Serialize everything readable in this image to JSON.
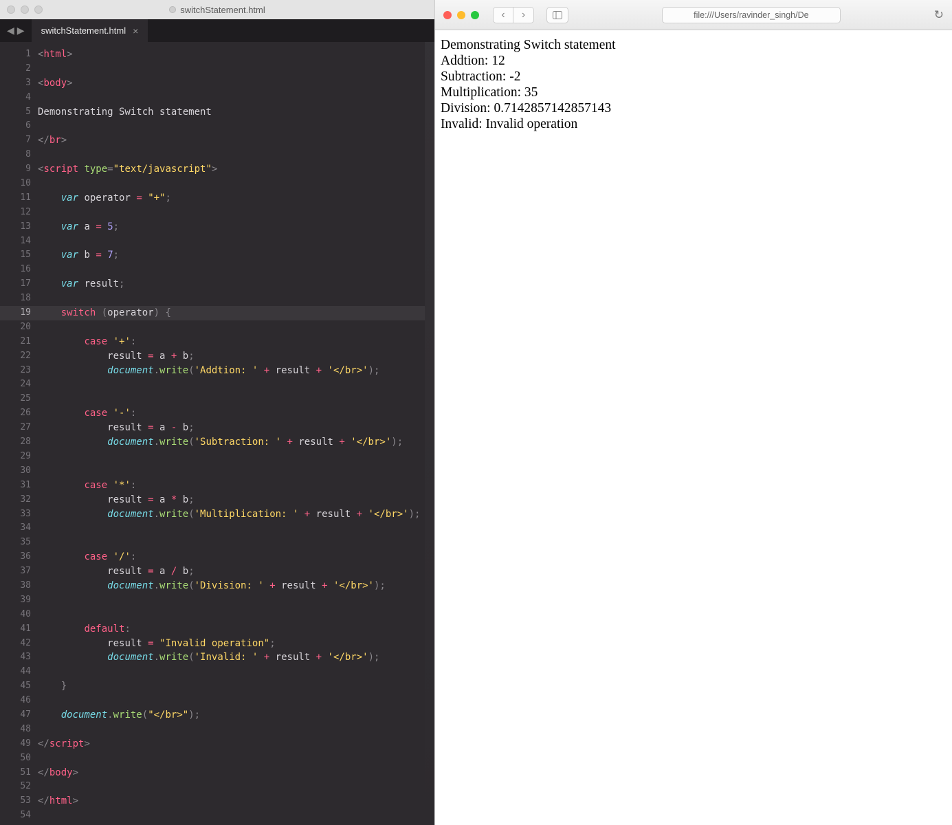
{
  "editor": {
    "window_title": "switchStatement.html",
    "tab": {
      "label": "switchStatement.html",
      "close": "×"
    },
    "arrows": {
      "back": "◀",
      "forward": "▶"
    },
    "line_count": 54,
    "current_line": 19,
    "code_lines": [
      {
        "t": "tagline",
        "parts": [
          {
            "c": "c-punc",
            "t": "<"
          },
          {
            "c": "c-tag",
            "t": "html"
          },
          {
            "c": "c-punc",
            "t": ">"
          }
        ]
      },
      {
        "t": "blank"
      },
      {
        "t": "tagline",
        "parts": [
          {
            "c": "c-punc",
            "t": "<"
          },
          {
            "c": "c-tag",
            "t": "body"
          },
          {
            "c": "c-punc",
            "t": ">"
          }
        ]
      },
      {
        "t": "blank"
      },
      {
        "t": "text",
        "parts": [
          {
            "c": "c-var",
            "t": "Demonstrating Switch statement"
          }
        ]
      },
      {
        "t": "blank"
      },
      {
        "t": "tagline",
        "parts": [
          {
            "c": "c-punc",
            "t": "</"
          },
          {
            "c": "c-tag",
            "t": "br"
          },
          {
            "c": "c-punc",
            "t": ">"
          }
        ]
      },
      {
        "t": "blank"
      },
      {
        "t": "tagline",
        "parts": [
          {
            "c": "c-punc",
            "t": "<"
          },
          {
            "c": "c-tag",
            "t": "script"
          },
          {
            "c": "",
            "t": " "
          },
          {
            "c": "c-attr",
            "t": "type"
          },
          {
            "c": "c-punc",
            "t": "="
          },
          {
            "c": "c-str",
            "t": "\"text/javascript\""
          },
          {
            "c": "c-punc",
            "t": ">"
          }
        ]
      },
      {
        "t": "blank"
      },
      {
        "t": "code",
        "indent": 1,
        "parts": [
          {
            "c": "c-kw",
            "t": "var"
          },
          {
            "c": "",
            "t": " "
          },
          {
            "c": "c-var",
            "t": "operator"
          },
          {
            "c": "",
            "t": " "
          },
          {
            "c": "c-op",
            "t": "="
          },
          {
            "c": "",
            "t": " "
          },
          {
            "c": "c-str",
            "t": "\"+\""
          },
          {
            "c": "c-punc",
            "t": ";"
          }
        ]
      },
      {
        "t": "blank"
      },
      {
        "t": "code",
        "indent": 1,
        "parts": [
          {
            "c": "c-kw",
            "t": "var"
          },
          {
            "c": "",
            "t": " "
          },
          {
            "c": "c-var",
            "t": "a"
          },
          {
            "c": "",
            "t": " "
          },
          {
            "c": "c-op",
            "t": "="
          },
          {
            "c": "",
            "t": " "
          },
          {
            "c": "c-num",
            "t": "5"
          },
          {
            "c": "c-punc",
            "t": ";"
          }
        ]
      },
      {
        "t": "blank"
      },
      {
        "t": "code",
        "indent": 1,
        "parts": [
          {
            "c": "c-kw",
            "t": "var"
          },
          {
            "c": "",
            "t": " "
          },
          {
            "c": "c-var",
            "t": "b"
          },
          {
            "c": "",
            "t": " "
          },
          {
            "c": "c-op",
            "t": "="
          },
          {
            "c": "",
            "t": " "
          },
          {
            "c": "c-num",
            "t": "7"
          },
          {
            "c": "c-punc",
            "t": ";"
          }
        ]
      },
      {
        "t": "blank"
      },
      {
        "t": "code",
        "indent": 1,
        "parts": [
          {
            "c": "c-kw",
            "t": "var"
          },
          {
            "c": "",
            "t": " "
          },
          {
            "c": "c-var",
            "t": "result"
          },
          {
            "c": "c-punc",
            "t": ";"
          }
        ]
      },
      {
        "t": "blank"
      },
      {
        "t": "code",
        "indent": 1,
        "parts": [
          {
            "c": "c-kw2",
            "t": "switch"
          },
          {
            "c": "",
            "t": " "
          },
          {
            "c": "c-punc",
            "t": "("
          },
          {
            "c": "c-var",
            "t": "operator"
          },
          {
            "c": "c-punc",
            "t": ")"
          },
          {
            "c": "",
            "t": " "
          },
          {
            "c": "c-punc",
            "t": "{"
          }
        ]
      },
      {
        "t": "blank"
      },
      {
        "t": "code",
        "indent": 2,
        "parts": [
          {
            "c": "c-kw2",
            "t": "case"
          },
          {
            "c": "",
            "t": " "
          },
          {
            "c": "c-str",
            "t": "'+'"
          },
          {
            "c": "c-punc",
            "t": ":"
          }
        ]
      },
      {
        "t": "code",
        "indent": 3,
        "parts": [
          {
            "c": "c-var",
            "t": "result"
          },
          {
            "c": "",
            "t": " "
          },
          {
            "c": "c-op",
            "t": "="
          },
          {
            "c": "",
            "t": " "
          },
          {
            "c": "c-var",
            "t": "a"
          },
          {
            "c": "",
            "t": " "
          },
          {
            "c": "c-op",
            "t": "+"
          },
          {
            "c": "",
            "t": " "
          },
          {
            "c": "c-var",
            "t": "b"
          },
          {
            "c": "c-punc",
            "t": ";"
          }
        ]
      },
      {
        "t": "code",
        "indent": 3,
        "parts": [
          {
            "c": "c-obj",
            "t": "document"
          },
          {
            "c": "c-punc",
            "t": "."
          },
          {
            "c": "c-fn",
            "t": "write"
          },
          {
            "c": "c-punc",
            "t": "("
          },
          {
            "c": "c-str",
            "t": "'Addtion: '"
          },
          {
            "c": "",
            "t": " "
          },
          {
            "c": "c-op",
            "t": "+"
          },
          {
            "c": "",
            "t": " "
          },
          {
            "c": "c-var",
            "t": "result"
          },
          {
            "c": "",
            "t": " "
          },
          {
            "c": "c-op",
            "t": "+"
          },
          {
            "c": "",
            "t": " "
          },
          {
            "c": "c-str",
            "t": "'</br>'"
          },
          {
            "c": "c-punc",
            "t": ");"
          }
        ]
      },
      {
        "t": "blank"
      },
      {
        "t": "blank"
      },
      {
        "t": "code",
        "indent": 2,
        "parts": [
          {
            "c": "c-kw2",
            "t": "case"
          },
          {
            "c": "",
            "t": " "
          },
          {
            "c": "c-str",
            "t": "'-'"
          },
          {
            "c": "c-punc",
            "t": ":"
          }
        ]
      },
      {
        "t": "code",
        "indent": 3,
        "parts": [
          {
            "c": "c-var",
            "t": "result"
          },
          {
            "c": "",
            "t": " "
          },
          {
            "c": "c-op",
            "t": "="
          },
          {
            "c": "",
            "t": " "
          },
          {
            "c": "c-var",
            "t": "a"
          },
          {
            "c": "",
            "t": " "
          },
          {
            "c": "c-op",
            "t": "-"
          },
          {
            "c": "",
            "t": " "
          },
          {
            "c": "c-var",
            "t": "b"
          },
          {
            "c": "c-punc",
            "t": ";"
          }
        ]
      },
      {
        "t": "code",
        "indent": 3,
        "parts": [
          {
            "c": "c-obj",
            "t": "document"
          },
          {
            "c": "c-punc",
            "t": "."
          },
          {
            "c": "c-fn",
            "t": "write"
          },
          {
            "c": "c-punc",
            "t": "("
          },
          {
            "c": "c-str",
            "t": "'Subtraction: '"
          },
          {
            "c": "",
            "t": " "
          },
          {
            "c": "c-op",
            "t": "+"
          },
          {
            "c": "",
            "t": " "
          },
          {
            "c": "c-var",
            "t": "result"
          },
          {
            "c": "",
            "t": " "
          },
          {
            "c": "c-op",
            "t": "+"
          },
          {
            "c": "",
            "t": " "
          },
          {
            "c": "c-str",
            "t": "'</br>'"
          },
          {
            "c": "c-punc",
            "t": ");"
          }
        ]
      },
      {
        "t": "blank"
      },
      {
        "t": "blank"
      },
      {
        "t": "code",
        "indent": 2,
        "parts": [
          {
            "c": "c-kw2",
            "t": "case"
          },
          {
            "c": "",
            "t": " "
          },
          {
            "c": "c-str",
            "t": "'*'"
          },
          {
            "c": "c-punc",
            "t": ":"
          }
        ]
      },
      {
        "t": "code",
        "indent": 3,
        "parts": [
          {
            "c": "c-var",
            "t": "result"
          },
          {
            "c": "",
            "t": " "
          },
          {
            "c": "c-op",
            "t": "="
          },
          {
            "c": "",
            "t": " "
          },
          {
            "c": "c-var",
            "t": "a"
          },
          {
            "c": "",
            "t": " "
          },
          {
            "c": "c-op",
            "t": "*"
          },
          {
            "c": "",
            "t": " "
          },
          {
            "c": "c-var",
            "t": "b"
          },
          {
            "c": "c-punc",
            "t": ";"
          }
        ]
      },
      {
        "t": "code",
        "indent": 3,
        "parts": [
          {
            "c": "c-obj",
            "t": "document"
          },
          {
            "c": "c-punc",
            "t": "."
          },
          {
            "c": "c-fn",
            "t": "write"
          },
          {
            "c": "c-punc",
            "t": "("
          },
          {
            "c": "c-str",
            "t": "'Multiplication: '"
          },
          {
            "c": "",
            "t": " "
          },
          {
            "c": "c-op",
            "t": "+"
          },
          {
            "c": "",
            "t": " "
          },
          {
            "c": "c-var",
            "t": "result"
          },
          {
            "c": "",
            "t": " "
          },
          {
            "c": "c-op",
            "t": "+"
          },
          {
            "c": "",
            "t": " "
          },
          {
            "c": "c-str",
            "t": "'</br>'"
          },
          {
            "c": "c-punc",
            "t": ");"
          }
        ]
      },
      {
        "t": "blank"
      },
      {
        "t": "blank"
      },
      {
        "t": "code",
        "indent": 2,
        "parts": [
          {
            "c": "c-kw2",
            "t": "case"
          },
          {
            "c": "",
            "t": " "
          },
          {
            "c": "c-str",
            "t": "'/'"
          },
          {
            "c": "c-punc",
            "t": ":"
          }
        ]
      },
      {
        "t": "code",
        "indent": 3,
        "parts": [
          {
            "c": "c-var",
            "t": "result"
          },
          {
            "c": "",
            "t": " "
          },
          {
            "c": "c-op",
            "t": "="
          },
          {
            "c": "",
            "t": " "
          },
          {
            "c": "c-var",
            "t": "a"
          },
          {
            "c": "",
            "t": " "
          },
          {
            "c": "c-op",
            "t": "/"
          },
          {
            "c": "",
            "t": " "
          },
          {
            "c": "c-var",
            "t": "b"
          },
          {
            "c": "c-punc",
            "t": ";"
          }
        ]
      },
      {
        "t": "code",
        "indent": 3,
        "parts": [
          {
            "c": "c-obj",
            "t": "document"
          },
          {
            "c": "c-punc",
            "t": "."
          },
          {
            "c": "c-fn",
            "t": "write"
          },
          {
            "c": "c-punc",
            "t": "("
          },
          {
            "c": "c-str",
            "t": "'Division: '"
          },
          {
            "c": "",
            "t": " "
          },
          {
            "c": "c-op",
            "t": "+"
          },
          {
            "c": "",
            "t": " "
          },
          {
            "c": "c-var",
            "t": "result"
          },
          {
            "c": "",
            "t": " "
          },
          {
            "c": "c-op",
            "t": "+"
          },
          {
            "c": "",
            "t": " "
          },
          {
            "c": "c-str",
            "t": "'</br>'"
          },
          {
            "c": "c-punc",
            "t": ");"
          }
        ]
      },
      {
        "t": "blank"
      },
      {
        "t": "blank"
      },
      {
        "t": "code",
        "indent": 2,
        "parts": [
          {
            "c": "c-kw2",
            "t": "default"
          },
          {
            "c": "c-punc",
            "t": ":"
          }
        ]
      },
      {
        "t": "code",
        "indent": 3,
        "parts": [
          {
            "c": "c-var",
            "t": "result"
          },
          {
            "c": "",
            "t": " "
          },
          {
            "c": "c-op",
            "t": "="
          },
          {
            "c": "",
            "t": " "
          },
          {
            "c": "c-str",
            "t": "\"Invalid operation\""
          },
          {
            "c": "c-punc",
            "t": ";"
          }
        ]
      },
      {
        "t": "code",
        "indent": 3,
        "parts": [
          {
            "c": "c-obj",
            "t": "document"
          },
          {
            "c": "c-punc",
            "t": "."
          },
          {
            "c": "c-fn",
            "t": "write"
          },
          {
            "c": "c-punc",
            "t": "("
          },
          {
            "c": "c-str",
            "t": "'Invalid: '"
          },
          {
            "c": "",
            "t": " "
          },
          {
            "c": "c-op",
            "t": "+"
          },
          {
            "c": "",
            "t": " "
          },
          {
            "c": "c-var",
            "t": "result"
          },
          {
            "c": "",
            "t": " "
          },
          {
            "c": "c-op",
            "t": "+"
          },
          {
            "c": "",
            "t": " "
          },
          {
            "c": "c-str",
            "t": "'</br>'"
          },
          {
            "c": "c-punc",
            "t": ");"
          }
        ]
      },
      {
        "t": "blank"
      },
      {
        "t": "code",
        "indent": 1,
        "parts": [
          {
            "c": "c-punc",
            "t": "}"
          }
        ]
      },
      {
        "t": "blank"
      },
      {
        "t": "code",
        "indent": 1,
        "parts": [
          {
            "c": "c-obj",
            "t": "document"
          },
          {
            "c": "c-punc",
            "t": "."
          },
          {
            "c": "c-fn",
            "t": "write"
          },
          {
            "c": "c-punc",
            "t": "("
          },
          {
            "c": "c-str",
            "t": "\"</br>\""
          },
          {
            "c": "c-punc",
            "t": ");"
          }
        ]
      },
      {
        "t": "blank"
      },
      {
        "t": "tagline",
        "parts": [
          {
            "c": "c-punc",
            "t": "</"
          },
          {
            "c": "c-tag",
            "t": "script"
          },
          {
            "c": "c-punc",
            "t": ">"
          }
        ]
      },
      {
        "t": "blank"
      },
      {
        "t": "tagline",
        "parts": [
          {
            "c": "c-punc",
            "t": "</"
          },
          {
            "c": "c-tag",
            "t": "body"
          },
          {
            "c": "c-punc",
            "t": ">"
          }
        ]
      },
      {
        "t": "blank"
      },
      {
        "t": "tagline",
        "parts": [
          {
            "c": "c-punc",
            "t": "</"
          },
          {
            "c": "c-tag",
            "t": "html"
          },
          {
            "c": "c-punc",
            "t": ">"
          }
        ]
      },
      {
        "t": "blank"
      }
    ]
  },
  "browser": {
    "url": "file:///Users/ravinder_singh/De",
    "nav": {
      "back": "‹",
      "forward": "›",
      "reload": "↻"
    },
    "output_lines": [
      "Demonstrating Switch statement",
      "Addtion: 12",
      "Subtraction: -2",
      "Multiplication: 35",
      "Division: 0.7142857142857143",
      "Invalid: Invalid operation"
    ]
  }
}
